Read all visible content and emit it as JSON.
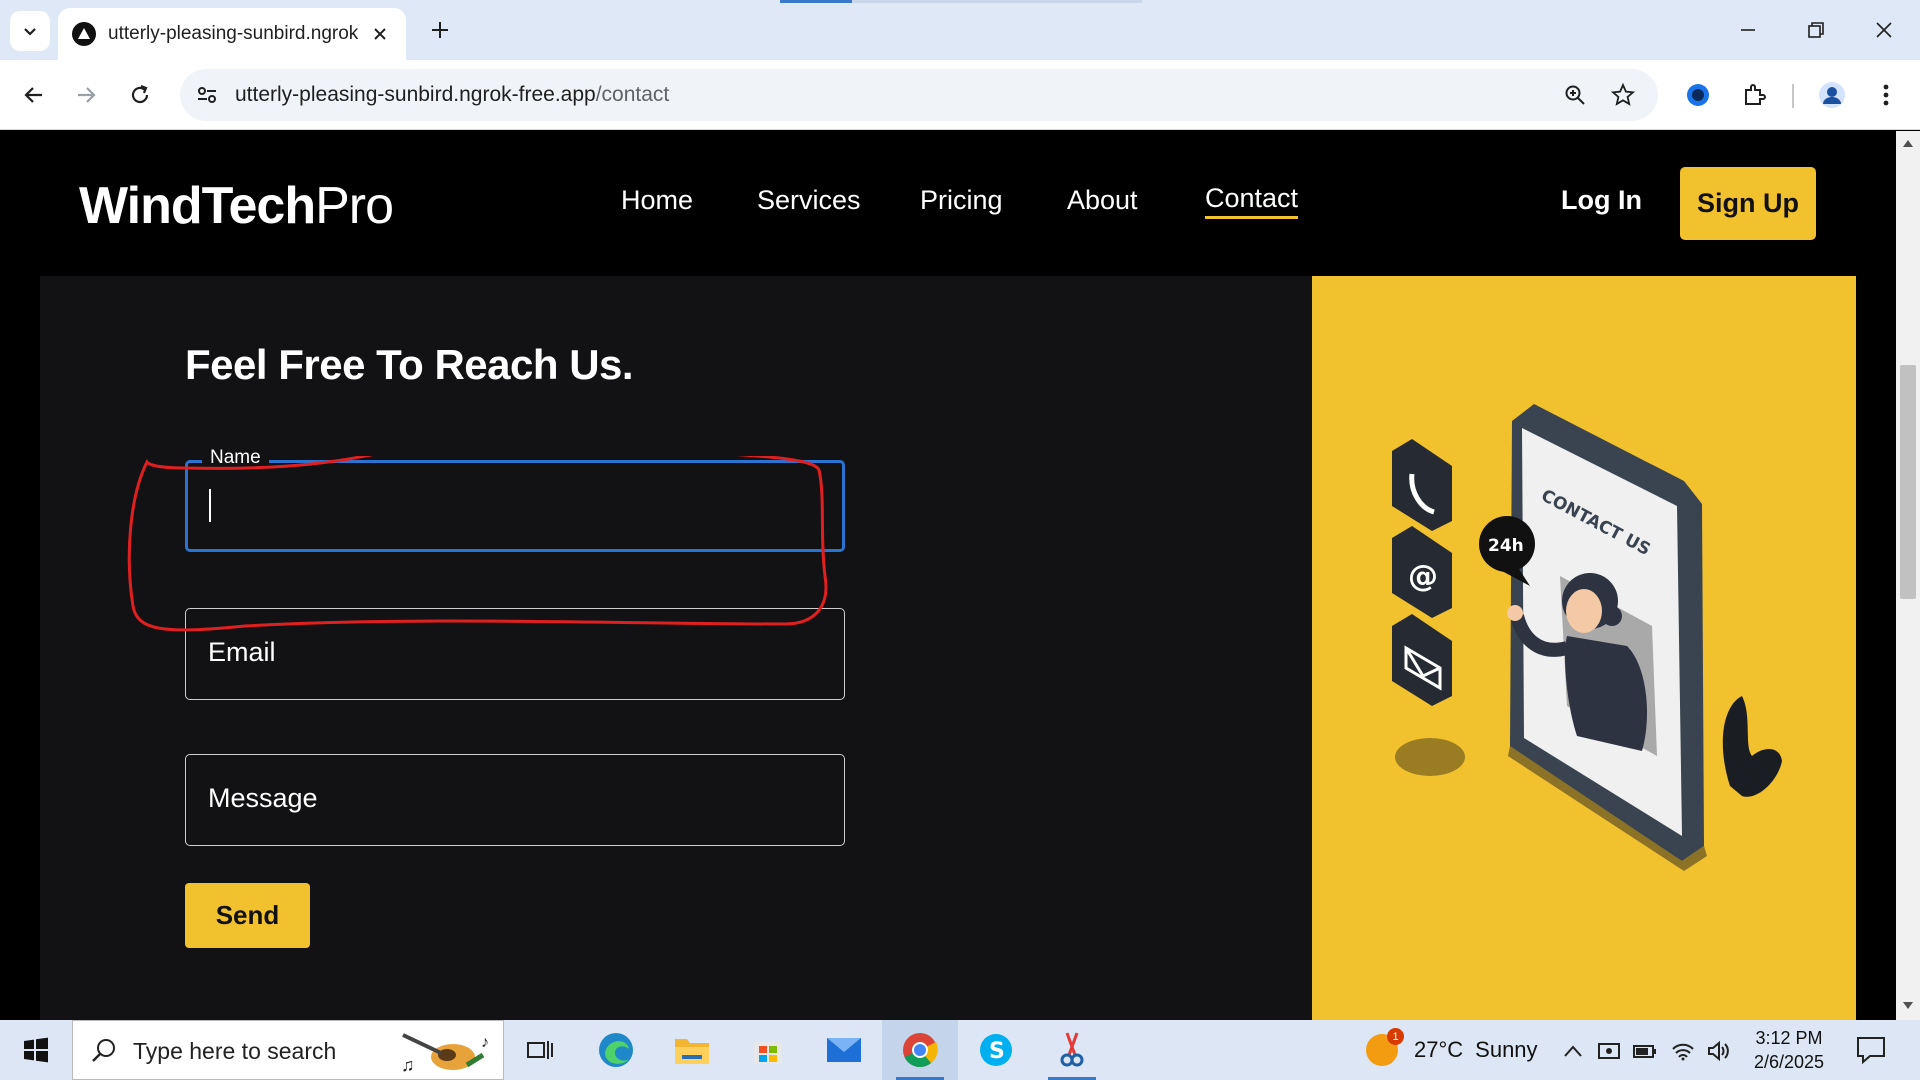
{
  "browser": {
    "tab": {
      "title": "utterly-pleasing-sunbird.ngrok-"
    },
    "url": {
      "host": "utterly-pleasing-sunbird.ngrok-free.app",
      "path": "/contact"
    }
  },
  "site": {
    "logo": {
      "bold": "WindTech",
      "light": "Pro"
    },
    "nav": [
      "Home",
      "Services",
      "Pricing",
      "About",
      "Contact"
    ],
    "login_label": "Log In",
    "signup_label": "Sign Up"
  },
  "contact": {
    "heading": "Feel Free To Reach Us.",
    "name_label": "Name",
    "email_placeholder": "Email",
    "message_placeholder": "Message",
    "send_label": "Send"
  },
  "illustration": {
    "sign_text": "CONTACT US",
    "badge_text": "24h"
  },
  "taskbar": {
    "search_placeholder": "Type here to search",
    "weather_temp": "27°C",
    "weather_desc": "Sunny",
    "weather_badge": "1",
    "time": "3:12 PM",
    "date": "2/6/2025"
  },
  "colors": {
    "accent_yellow": "#f2c12e",
    "focus_blue": "#2b73d2",
    "annotation_red": "#e02020"
  }
}
